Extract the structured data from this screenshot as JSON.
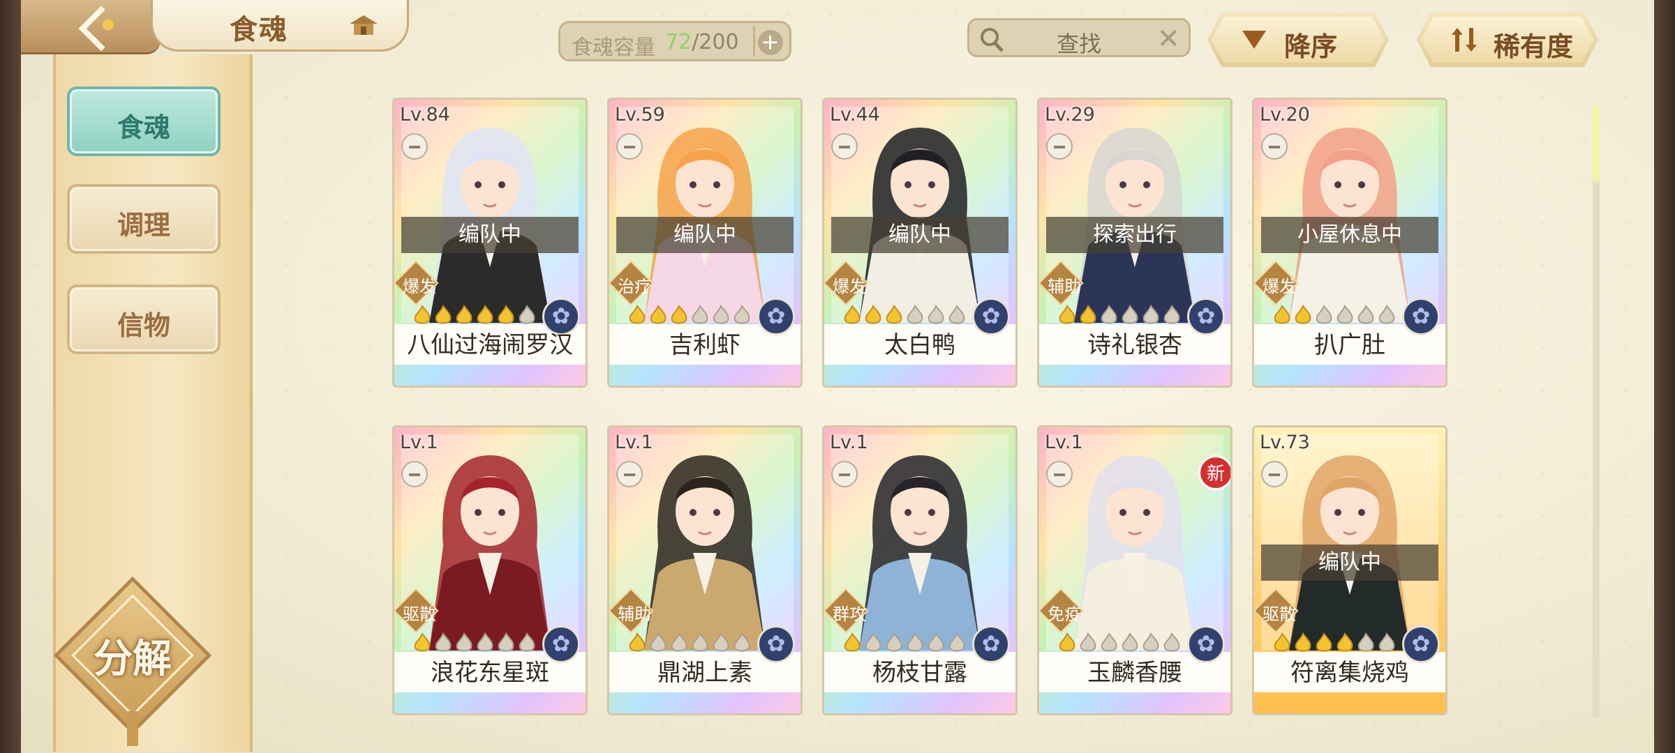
{
  "header": {
    "title": "食魂",
    "capacity_label": "食魂容量",
    "capacity_current": "72",
    "capacity_max": "/200",
    "search_placeholder": "查找",
    "sort_order_label": "降序",
    "sort_key_label": "稀有度"
  },
  "sidebar": {
    "items": [
      {
        "label": "食魂",
        "active": true
      },
      {
        "label": "调理",
        "active": false
      },
      {
        "label": "信物",
        "active": false
      }
    ],
    "decompose_label": "分解"
  },
  "cards": [
    {
      "level": "Lv.84",
      "name": "八仙过海闹罗汉",
      "status": "编队中",
      "role": "爆发",
      "stars_lit": 5,
      "hair": "#dfe4f5",
      "coat": "#2b2b2b"
    },
    {
      "level": "Lv.59",
      "name": "吉利虾",
      "status": "编队中",
      "role": "治疗",
      "stars_lit": 3,
      "hair": "#f6a24a",
      "coat": "#f6d7e6"
    },
    {
      "level": "Lv.44",
      "name": "太白鸭",
      "status": "编队中",
      "role": "爆发",
      "stars_lit": 3,
      "hair": "#1f1f24",
      "coat": "#f1eee4"
    },
    {
      "level": "Lv.29",
      "name": "诗礼银杏",
      "status": "探索出行",
      "role": "辅助",
      "stars_lit": 2,
      "hair": "#d9d6d2",
      "coat": "#2c3558"
    },
    {
      "level": "Lv.20",
      "name": "扒广肚",
      "status": "小屋休息中",
      "role": "爆发",
      "stars_lit": 2,
      "hair": "#f2a08a",
      "coat": "#f4f1e6"
    },
    {
      "level": "Lv.1",
      "name": "浪花东星斑",
      "status": "",
      "role": "驱散",
      "stars_lit": 1,
      "hair": "#a5242c",
      "coat": "#7a1b22"
    },
    {
      "level": "Lv.1",
      "name": "鼎湖上素",
      "status": "",
      "role": "辅助",
      "stars_lit": 1,
      "hair": "#2b241e",
      "coat": "#cba86e"
    },
    {
      "level": "Lv.1",
      "name": "杨枝甘露",
      "status": "",
      "role": "群攻",
      "stars_lit": 1,
      "hair": "#26232a",
      "coat": "#8fb3d6"
    },
    {
      "level": "Lv.1",
      "name": "玉麟香腰",
      "status": "",
      "role": "免疫",
      "stars_lit": 1,
      "hair": "#e3e0ee",
      "coat": "#f5efe0",
      "new": "新"
    },
    {
      "level": "Lv.73",
      "name": "符离集烧鸡",
      "status": "编队中",
      "role": "驱散",
      "stars_lit": 4,
      "hair": "#e0a466",
      "coat": "#222a2a",
      "gold": true
    }
  ]
}
